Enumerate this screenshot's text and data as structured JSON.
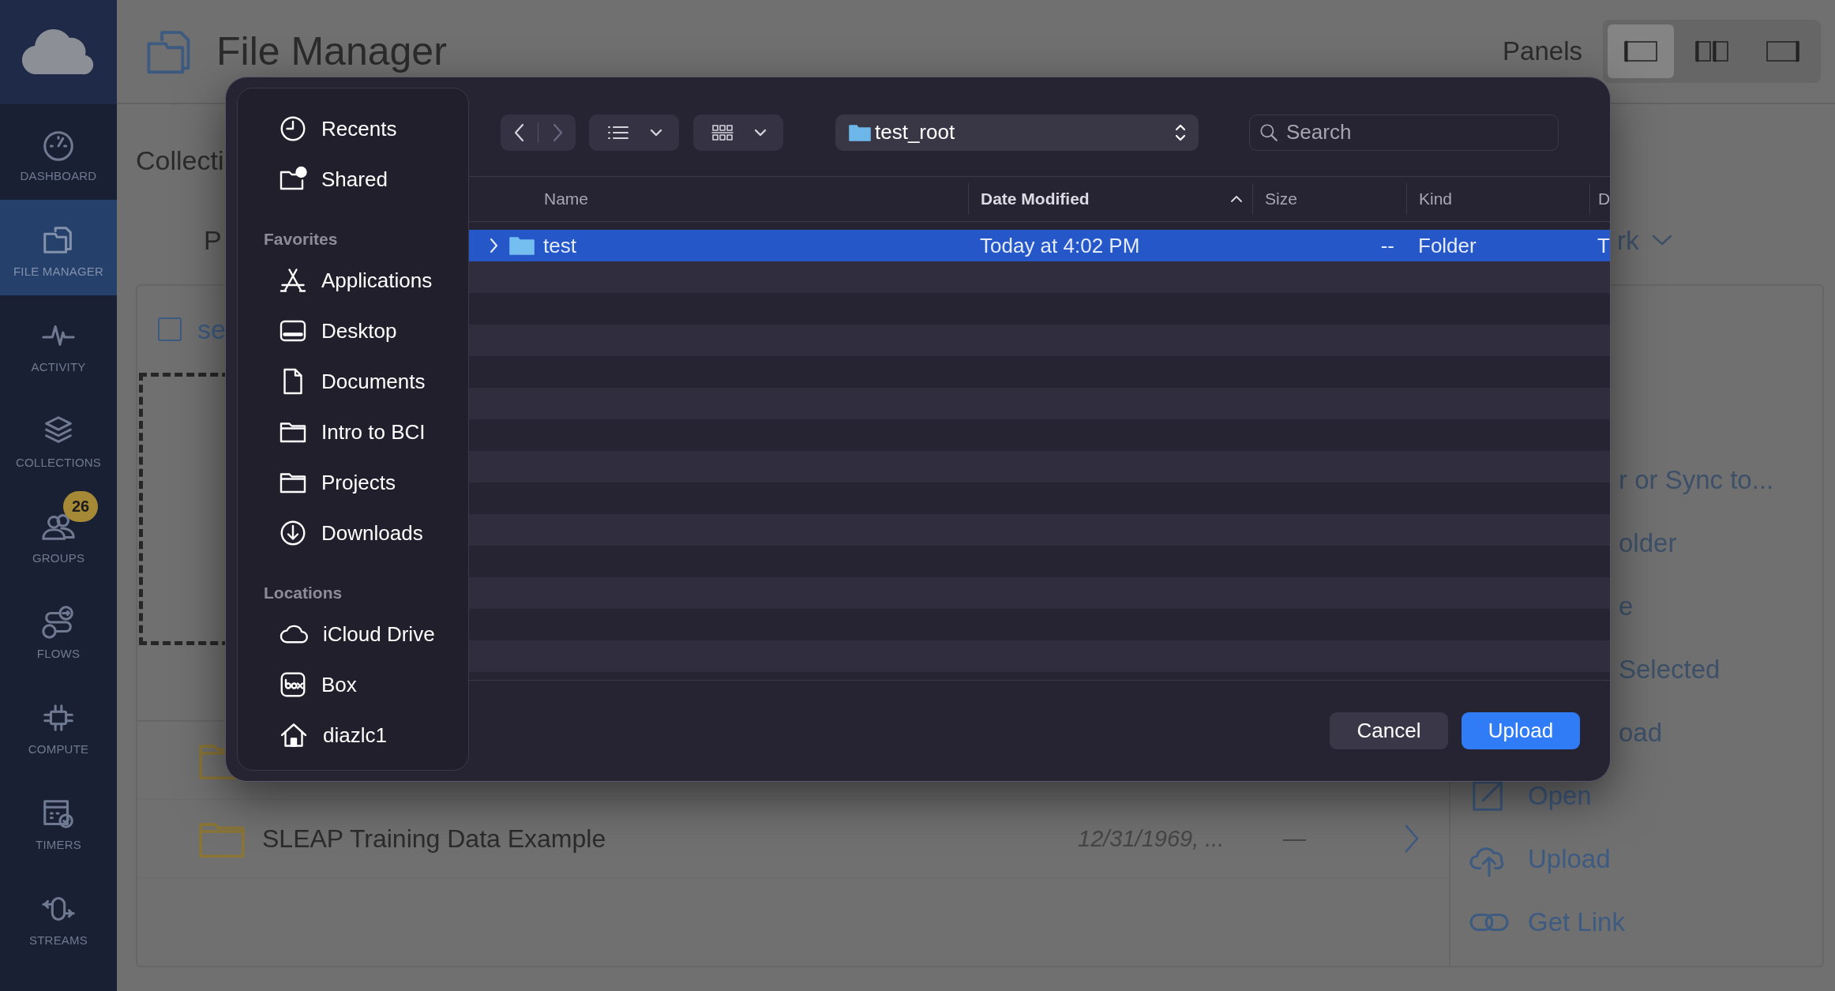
{
  "sidebar": {
    "items": [
      {
        "kind": "dashboard",
        "label": "DASHBOARD",
        "selected": false
      },
      {
        "kind": "files",
        "label": "FILE MANAGER",
        "selected": true
      },
      {
        "kind": "activity",
        "label": "ACTIVITY",
        "selected": false
      },
      {
        "kind": "collections",
        "label": "COLLECTIONS",
        "selected": false
      },
      {
        "kind": "groups",
        "label": "GROUPS",
        "selected": false,
        "badge": "26"
      },
      {
        "kind": "flows",
        "label": "FLOWS",
        "selected": false
      },
      {
        "kind": "compute",
        "label": "COMPUTE",
        "selected": false
      },
      {
        "kind": "timers",
        "label": "TIMERS",
        "selected": false
      },
      {
        "kind": "streams",
        "label": "STREAMS",
        "selected": false
      }
    ]
  },
  "header": {
    "title": "File Manager",
    "panels_label": "Panels",
    "panel_modes": [
      {
        "kind": "single",
        "selected": true
      },
      {
        "kind": "split",
        "selected": false
      },
      {
        "kind": "wide",
        "selected": false
      }
    ]
  },
  "page": {
    "collection_label": "Collecti",
    "path_label": "P",
    "trailing_text": "rk",
    "select_label": "se",
    "select_checked": false,
    "rows": [
      {
        "kind": "folder"
      },
      {
        "kind": "folder",
        "name": "SLEAP Training Data Example",
        "modified": "12/31/1969, ...",
        "size": "—"
      }
    ]
  },
  "actions": [
    {
      "kind": "clipped",
      "label": "r or Sync to..."
    },
    {
      "kind": "clipped",
      "label": "older"
    },
    {
      "kind": "clipped",
      "label": "e"
    },
    {
      "kind": "clipped",
      "label": "Selected"
    },
    {
      "kind": "clipped",
      "label": "oad"
    },
    {
      "kind": "open",
      "label": "Open"
    },
    {
      "kind": "upload",
      "label": "Upload"
    },
    {
      "kind": "link",
      "label": "Get Link"
    }
  ],
  "dialog": {
    "sidebar": [
      {
        "items": [
          {
            "label": "Recents"
          },
          {
            "label": "Shared"
          }
        ]
      },
      {
        "heading": "Favorites",
        "items": [
          {
            "label": "Applications"
          },
          {
            "label": "Desktop"
          },
          {
            "label": "Documents"
          },
          {
            "label": "Intro to BCI"
          },
          {
            "label": "Projects"
          },
          {
            "label": "Downloads"
          }
        ]
      },
      {
        "heading": "Locations",
        "items": [
          {
            "label": "iCloud Drive"
          },
          {
            "label": "Box"
          },
          {
            "label": "diazlc1"
          }
        ]
      }
    ],
    "nav": [
      {
        "kind": "back",
        "disabled": false
      },
      {
        "kind": "forward",
        "disabled": true
      }
    ],
    "path": "test_root",
    "search": {
      "placeholder": "Search"
    },
    "columns": [
      {
        "label": "Name",
        "sorted": false
      },
      {
        "label": "Date Modified",
        "sorted": true
      },
      {
        "label": "Size",
        "sorted": false
      },
      {
        "label": "Kind",
        "sorted": false
      },
      {
        "label": "D",
        "sorted": false
      }
    ],
    "rows": [
      {
        "name": "test",
        "modified": "Today at 4:02 PM",
        "size": "--",
        "kind": "Folder",
        "column_5": "T",
        "selected": true,
        "expanded": false
      }
    ],
    "buttons": [
      {
        "kind": "secondary",
        "label": "Cancel"
      },
      {
        "kind": "primary",
        "label": "Upload"
      }
    ]
  }
}
